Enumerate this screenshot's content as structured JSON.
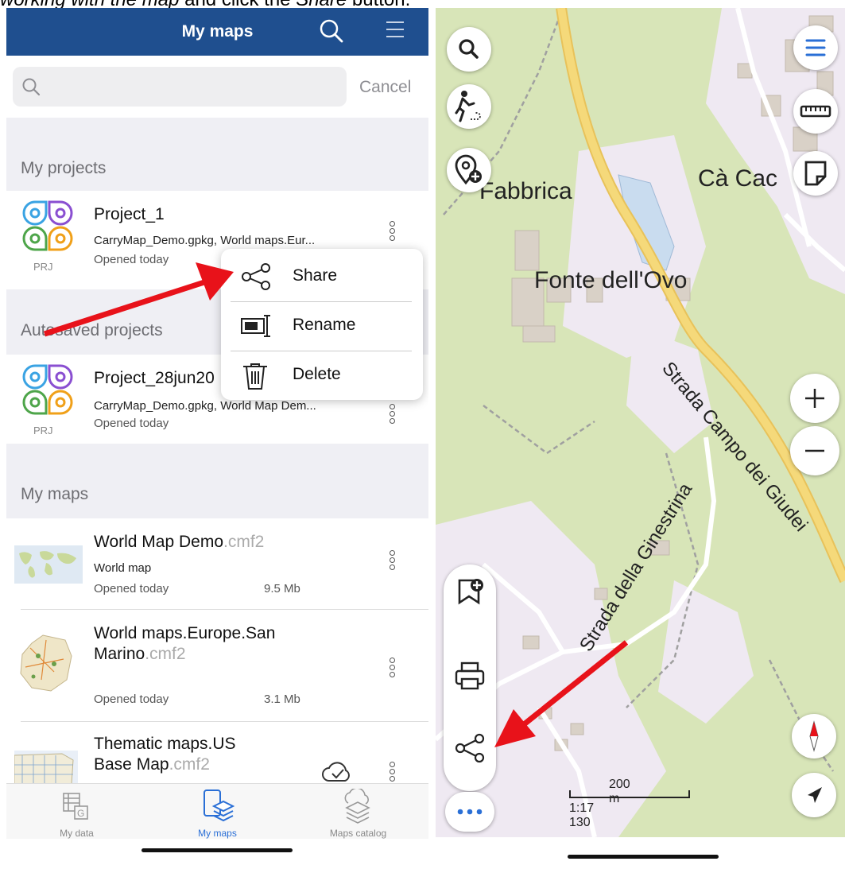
{
  "caption": {
    "italic_part": "working with the map",
    "middle": " and click the ",
    "italic_button": "Share",
    "end": " button."
  },
  "left": {
    "nav": {
      "title": "My maps",
      "search_icon": "search-icon",
      "menu_icon": "menu-icon"
    },
    "search": {
      "placeholder": "",
      "cancel_label": "Cancel"
    },
    "sections": {
      "projects": "My projects",
      "autosaved": "Autosaved projects",
      "maps": "My maps"
    },
    "projects": [
      {
        "name": "Project_1",
        "files": "CarryMap_Demo.gpkg, World maps.Eur...",
        "opened": "Opened today",
        "badge": "PRJ"
      }
    ],
    "autosaved": [
      {
        "name": "Project_28jun20",
        "files": "CarryMap_Demo.gpkg, World Map Dem...",
        "opened": "Opened today",
        "badge": "PRJ"
      }
    ],
    "maps": [
      {
        "name": "World Map Demo",
        "ext": ".cmf2",
        "desc": "World map",
        "opened": "Opened today",
        "size": "9.5 Mb"
      },
      {
        "name_line1": "World maps.Europe.San",
        "name_line2": "Marino",
        "ext": ".cmf2",
        "opened": "Opened today",
        "size": "3.1 Mb"
      },
      {
        "name_line1": "Thematic maps.US",
        "name_line2": "Base Map",
        "ext": ".cmf2",
        "cloud_icon": "cloud-check-icon"
      }
    ],
    "context_menu": {
      "share": "Share",
      "rename": "Rename",
      "delete": "Delete"
    },
    "tabs": [
      {
        "label": "My data",
        "icon": "table-icon",
        "active": false
      },
      {
        "label": "My maps",
        "icon": "layers-icon",
        "active": true
      },
      {
        "label": "Maps catalog",
        "icon": "cloud-layers-icon",
        "active": false
      }
    ],
    "colors": {
      "nav": "#1f4f8f",
      "accent": "#2a6fd6",
      "arrow": "#e8121a"
    }
  },
  "right": {
    "map_labels": {
      "place1": "Fabbrica",
      "place2": "Cà Cac",
      "place3": "Fonte dell'Ovo",
      "road1": "Strada Campo dei Giudei",
      "road2": "Strada della Ginestrina"
    },
    "scale": {
      "distance": "200 m",
      "ratio": "1:17 130"
    },
    "buttons": [
      "search-icon",
      "walk-route-icon",
      "add-location-icon",
      "menu-icon",
      "ruler-icon",
      "note-icon",
      "zoom-in-icon",
      "zoom-out-icon",
      "compass-icon",
      "navigation-icon",
      "add-bookmark-icon",
      "print-icon",
      "share-icon",
      "more-icon"
    ]
  }
}
